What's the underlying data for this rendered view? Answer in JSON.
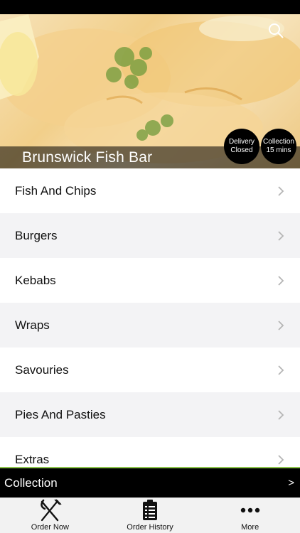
{
  "header": {
    "restaurant_name": "Brunswick Fish Bar",
    "search_icon": "search-icon"
  },
  "badges": {
    "delivery": {
      "line1": "Delivery",
      "line2": "Closed"
    },
    "collection": {
      "line1": "Collection",
      "line2": "15 mins"
    }
  },
  "menu": {
    "categories": [
      "Fish And Chips",
      "Burgers",
      "Kebabs",
      "Wraps",
      "Savouries",
      "Pies And Pasties",
      "Extras"
    ]
  },
  "order_mode": {
    "label": "Collection",
    "arrow": ">"
  },
  "tabs": [
    {
      "label": "Order Now",
      "icon": "fork-knife-icon"
    },
    {
      "label": "Order History",
      "icon": "clipboard-list-icon"
    },
    {
      "label": "More",
      "icon": "more-dots-icon"
    }
  ],
  "colors": {
    "accent": "#8bc34a",
    "bar_background": "#000000",
    "row_alt": "#f3f3f5"
  }
}
